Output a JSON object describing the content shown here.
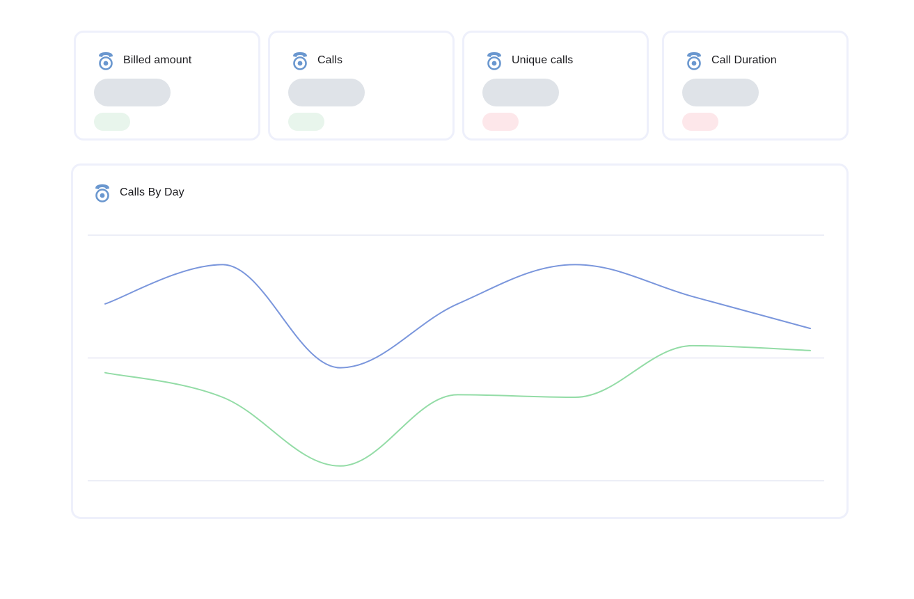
{
  "colors": {
    "icon": "#6a97cf",
    "series_calls": "#7a96dc",
    "series_unique": "#93dca6",
    "skeleton": "#dfe3e8",
    "delta_positive": "#e8f5ec",
    "delta_negative": "#fde7ea",
    "card_border": "#eef0fb",
    "gridline": "#eceef7"
  },
  "cards": [
    {
      "title": "Billed amount",
      "icon": "telephone-icon",
      "trend": "positive"
    },
    {
      "title": "Calls",
      "icon": "telephone-icon",
      "trend": "positive"
    },
    {
      "title": "Unique calls",
      "icon": "telephone-icon",
      "trend": "negative"
    },
    {
      "title": "Call Duration",
      "icon": "telephone-icon",
      "trend": "negative"
    }
  ],
  "chart": {
    "title": "Calls By Day",
    "icon": "telephone-icon"
  },
  "chart_data": {
    "type": "line",
    "title": "Calls By Day",
    "xlabel": "",
    "ylabel": "",
    "ylim": [
      0,
      100
    ],
    "grid": true,
    "gridlines": [
      0,
      50,
      100
    ],
    "legend": "none",
    "x": [
      0,
      1,
      2,
      3,
      4,
      5,
      6
    ],
    "series": [
      {
        "values": [
          72,
          88,
          46,
          72,
          88,
          75,
          62
        ],
        "color": "#7a96dc"
      },
      {
        "values": [
          44,
          34,
          6,
          35,
          34,
          55,
          53
        ],
        "color": "#93dca6"
      }
    ]
  }
}
